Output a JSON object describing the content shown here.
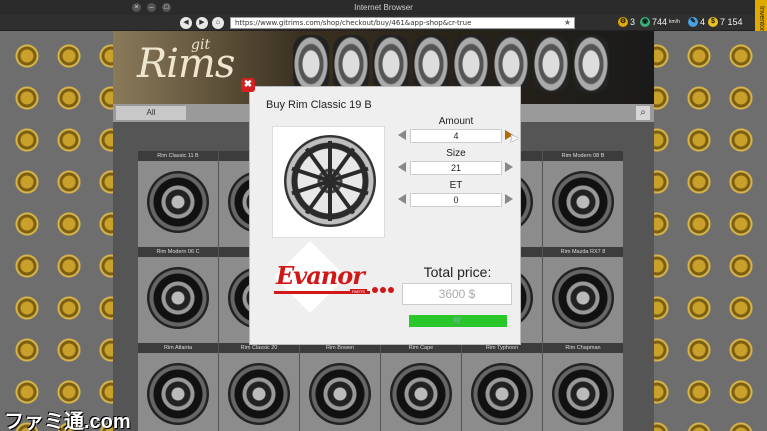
{
  "window": {
    "title": "Internet Browser"
  },
  "browser": {
    "url": "https://www.gitrims.com/shop/checkout/buy/461&app-shop&cr-true"
  },
  "hud": {
    "level": "3",
    "stat1": "744",
    "stat1_unit": "km/h",
    "stat2": "4",
    "money": "7 154",
    "inventory_label": "Inventory"
  },
  "shop": {
    "logo_main": "Rims",
    "logo_small": "git",
    "filter_all": "All",
    "cards_row1": [
      "Rim Classic 11 B",
      "Rim",
      "",
      "",
      "",
      "Rim Modern 08 B"
    ],
    "cards_row2": [
      "Rim Modern 06 C",
      "Rim Re",
      "",
      "",
      "A",
      "Rim Mazda RX7 8"
    ],
    "cards_row3": [
      "Rim Atlanta",
      "Rim Classic 20",
      "Rim Bowen",
      "Rim Cape",
      "Rim Typhoon",
      "Rim Chapman"
    ]
  },
  "modal": {
    "title": "Buy Rim Classic 19 B",
    "amount_label": "Amount",
    "amount_value": "4",
    "size_label": "Size",
    "size_value": "21",
    "et_label": "ET",
    "et_value": "0",
    "brand_name": "Evanor",
    "brand_sub": "PARTS",
    "total_label": "Total price:",
    "total_value": "3600 $",
    "buy_icon": "cart-icon"
  },
  "watermark": "ファミ通.com",
  "colors": {
    "close": "#d42020",
    "buy": "#2ac72a",
    "brand": "#d01818"
  }
}
